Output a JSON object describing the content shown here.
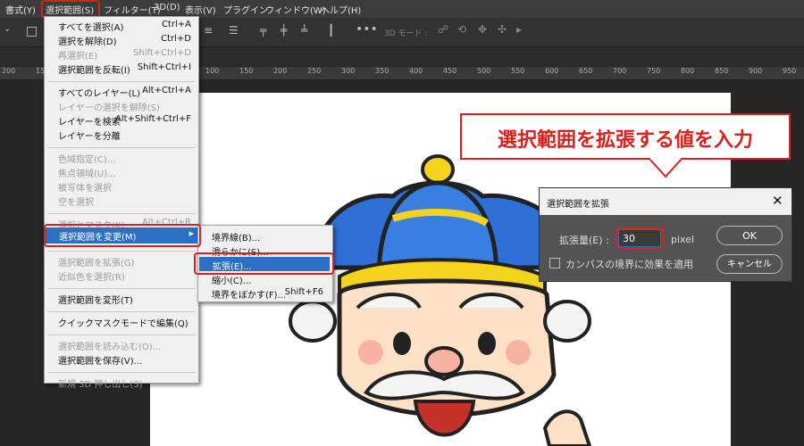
{
  "menubar": {
    "items": [
      "書式(Y)",
      "選択範囲(S)",
      "フィルター(T)",
      "3D(D)",
      "表示(V)",
      "プラグイン",
      "ウィンドウ(W)",
      "ヘルプ(H)"
    ]
  },
  "options_bar": {
    "mode_3d_label": "3D モード :"
  },
  "ruler": {
    "ticks": [
      "200",
      "150",
      "100",
      "50",
      "0",
      "50",
      "100",
      "150",
      "200",
      "250",
      "300",
      "350",
      "400",
      "450",
      "500",
      "550",
      "600",
      "650",
      "700",
      "750",
      "800",
      "850",
      "900",
      "950"
    ]
  },
  "select_menu": {
    "items": [
      {
        "label": "すべてを選択(A)",
        "shortcut": "Ctrl+A",
        "disabled": false
      },
      {
        "label": "選択を解除(D)",
        "shortcut": "Ctrl+D",
        "disabled": false
      },
      {
        "label": "再選択(E)",
        "shortcut": "Shift+Ctrl+D",
        "disabled": true
      },
      {
        "label": "選択範囲を反転(I)",
        "shortcut": "Shift+Ctrl+I",
        "disabled": false
      },
      {
        "label": "すべてのレイヤー(L)",
        "shortcut": "Alt+Ctrl+A",
        "disabled": false
      },
      {
        "label": "レイヤーの選択を解除(S)",
        "shortcut": "",
        "disabled": true
      },
      {
        "label": "レイヤーを検索",
        "shortcut": "Alt+Shift+Ctrl+F",
        "disabled": false
      },
      {
        "label": "レイヤーを分離",
        "shortcut": "",
        "disabled": false
      },
      {
        "label": "色域指定(C)...",
        "shortcut": "",
        "disabled": true
      },
      {
        "label": "焦点領域(U)...",
        "shortcut": "",
        "disabled": true
      },
      {
        "label": "被写体を選択",
        "shortcut": "",
        "disabled": true
      },
      {
        "label": "空を選択",
        "shortcut": "",
        "disabled": true
      },
      {
        "label": "選択とマスク(K)...",
        "shortcut": "Alt+Ctrl+R",
        "disabled": true
      },
      {
        "label": "選択範囲を変更(M)",
        "shortcut": "",
        "disabled": false
      },
      {
        "label": "選択範囲を拡張(G)",
        "shortcut": "",
        "disabled": true
      },
      {
        "label": "近似色を選択(R)",
        "shortcut": "",
        "disabled": true
      },
      {
        "label": "選択範囲を変形(T)",
        "shortcut": "",
        "disabled": false
      },
      {
        "label": "クイックマスクモードで編集(Q)",
        "shortcut": "",
        "disabled": false
      },
      {
        "label": "選択範囲を読み込む(O)...",
        "shortcut": "",
        "disabled": true
      },
      {
        "label": "選択範囲を保存(V)...",
        "shortcut": "",
        "disabled": false
      },
      {
        "label": "新規 3D 押し出し(3)",
        "shortcut": "",
        "disabled": true
      }
    ]
  },
  "submenu": {
    "items": [
      {
        "label": "境界線(B)...",
        "shortcut": ""
      },
      {
        "label": "滑らかに(S)...",
        "shortcut": ""
      },
      {
        "label": "拡張(E)...",
        "shortcut": ""
      },
      {
        "label": "縮小(C)...",
        "shortcut": ""
      },
      {
        "label": "境界をぼかす(F)...",
        "shortcut": "Shift+F6"
      }
    ]
  },
  "callout": {
    "text": "選択範囲を拡張する値を入力"
  },
  "dialog": {
    "title": "選択範囲を拡張",
    "field_label": "拡張量(E) :",
    "field_value": "30",
    "unit": "pixel",
    "checkbox_label": "カンバスの境界に効果を適用",
    "checkbox_checked": false,
    "ok_label": "OK",
    "cancel_label": "キャンセル"
  },
  "colors": {
    "highlight": "#2a6fc4",
    "annotation_red": "#d8201c"
  }
}
